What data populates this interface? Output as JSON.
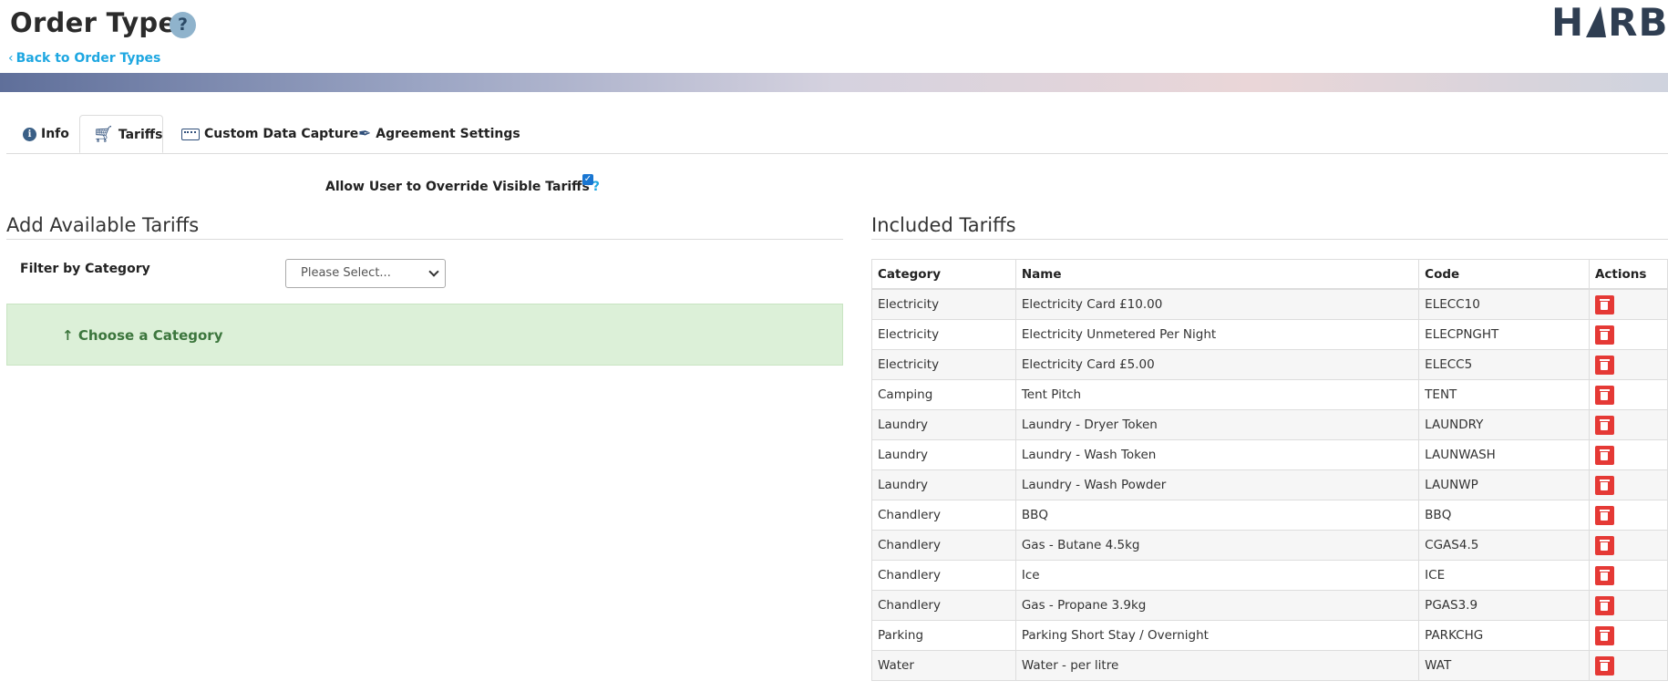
{
  "header": {
    "title": "Order Type",
    "help_label": "?",
    "back_link": "Back to Order Types",
    "logo_text_left": "H",
    "logo_text_right": "RBOU"
  },
  "tabs": [
    {
      "label": "Info",
      "icon": "info-icon"
    },
    {
      "label": "Tariffs",
      "icon": "cart-icon",
      "active": true
    },
    {
      "label": "Custom Data Capture",
      "icon": "keyboard-icon"
    },
    {
      "label": "Agreement Settings",
      "icon": "pen-icon"
    }
  ],
  "override": {
    "label": "Allow User to Override Visible Tariffs",
    "help": "?",
    "checked": true
  },
  "available": {
    "title": "Add Available Tariffs",
    "filter_label": "Filter by Category",
    "filter_value": "Please Select...",
    "choose_message": "Choose a Category"
  },
  "included": {
    "title": "Included Tariffs",
    "columns": [
      "Category",
      "Name",
      "Code",
      "Actions"
    ],
    "rows": [
      {
        "category": "Electricity",
        "name": "Electricity Card £10.00",
        "code": "ELECC10"
      },
      {
        "category": "Electricity",
        "name": "Electricity Unmetered Per Night",
        "code": "ELECPNGHT"
      },
      {
        "category": "Electricity",
        "name": "Electricity Card £5.00",
        "code": "ELECC5"
      },
      {
        "category": "Camping",
        "name": "Tent Pitch",
        "code": "TENT"
      },
      {
        "category": "Laundry",
        "name": "Laundry - Dryer Token",
        "code": "LAUNDRY"
      },
      {
        "category": "Laundry",
        "name": "Laundry - Wash Token",
        "code": "LAUNWASH"
      },
      {
        "category": "Laundry",
        "name": "Laundry - Wash Powder",
        "code": "LAUNWP"
      },
      {
        "category": "Chandlery",
        "name": "BBQ",
        "code": "BBQ"
      },
      {
        "category": "Chandlery",
        "name": "Gas - Butane 4.5kg",
        "code": "CGAS4.5"
      },
      {
        "category": "Chandlery",
        "name": "Ice",
        "code": "ICE"
      },
      {
        "category": "Chandlery",
        "name": "Gas - Propane 3.9kg",
        "code": "PGAS3.9"
      },
      {
        "category": "Parking",
        "name": "Parking Short Stay / Overnight",
        "code": "PARKCHG"
      },
      {
        "category": "Water",
        "name": "Water - per litre",
        "code": "WAT"
      }
    ]
  },
  "colors": {
    "link": "#1ea7e1",
    "delete": "#e53935",
    "success_bg": "#dcf0d8",
    "checkbox": "#1976d2"
  }
}
